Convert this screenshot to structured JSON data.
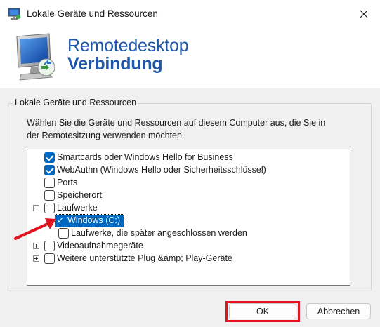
{
  "window": {
    "title": "Lokale Geräte und Ressourcen",
    "close_icon": "close-icon"
  },
  "banner": {
    "line1": "Remotedesktop",
    "line2": "Verbindung"
  },
  "group": {
    "label": "Lokale Geräte und Ressourcen",
    "description_line1": "Wählen Sie die Geräte und Ressourcen auf diesem Computer aus, die Sie in",
    "description_line2": "der Remotesitzung verwenden möchten."
  },
  "tree": {
    "items": [
      {
        "label": "Smartcards oder Windows Hello for Business",
        "checked": true
      },
      {
        "label": "WebAuthn (Windows Hello oder Sicherheitsschlüssel)",
        "checked": true
      },
      {
        "label": "Ports",
        "checked": false
      },
      {
        "label": "Speicherort",
        "checked": false
      },
      {
        "label": "Laufwerke",
        "checked": false,
        "expander": "collapse"
      },
      {
        "label": "Windows (C:)",
        "checked": true,
        "selected": true
      },
      {
        "label": "Laufwerke, die später angeschlossen werden",
        "checked": false
      },
      {
        "label": "Videoaufnahmegeräte",
        "checked": false,
        "expander": "expand"
      },
      {
        "label": "Weitere unterstützte Plug &amp; Play-Geräte",
        "checked": false,
        "expander": "expand"
      }
    ]
  },
  "buttons": {
    "ok": "OK",
    "cancel": "Abbrechen"
  },
  "colors": {
    "banner_text": "#1f56a8",
    "selection": "#0067c0",
    "annotation": "#e0141e"
  }
}
